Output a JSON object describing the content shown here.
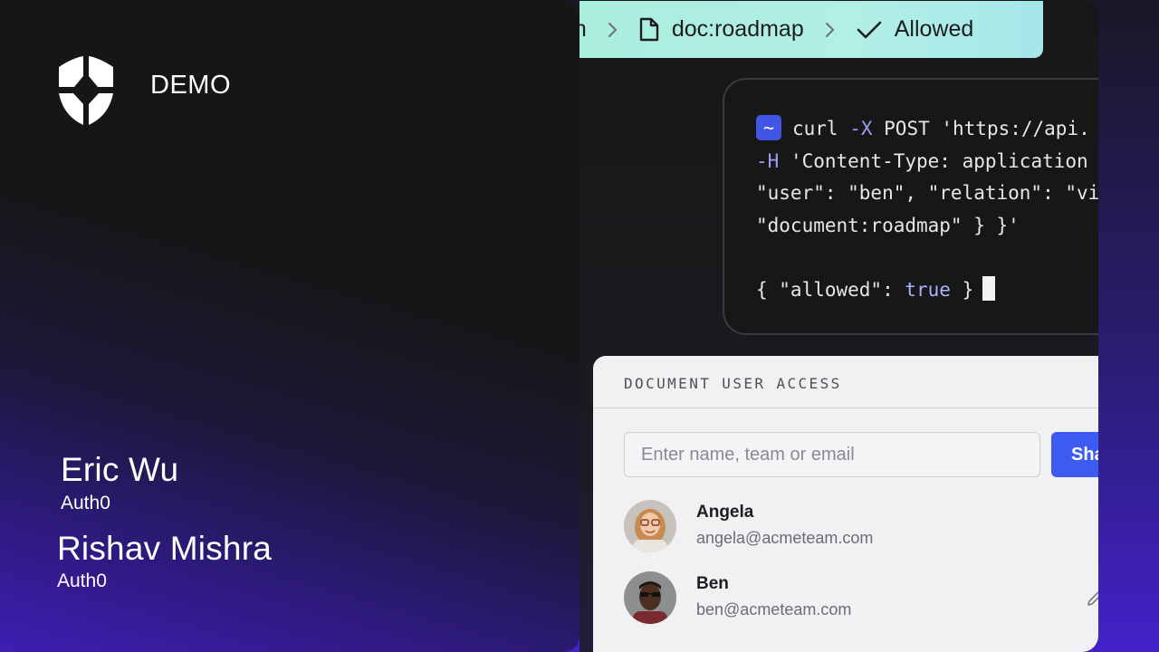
{
  "slide": {
    "brand_label": "DEMO",
    "speakers": [
      {
        "name": "Eric Wu",
        "org": "Auth0"
      },
      {
        "name": "Rishav Mishra",
        "org": "Auth0"
      }
    ]
  },
  "breadcrumb": {
    "user": "en",
    "document": "doc:roadmap",
    "result": "Allowed"
  },
  "terminal": {
    "prompt": "~",
    "line1_cmd": "curl ",
    "line1_flag": "-X",
    "line1_rest": " POST 'https://api.",
    "line2_flag": "-H",
    "line2_rest": " 'Content-Type: application",
    "line3": "\"user\": \"ben\", \"relation\": \"vi",
    "line4": "\"document:roadmap\" } }'",
    "response_prefix": "{ \"allowed\": ",
    "response_value": "true",
    "response_suffix": " }"
  },
  "access_card": {
    "title": "DOCUMENT USER ACCESS",
    "search_placeholder": "Enter name, team or email",
    "share_label": "Share",
    "users": [
      {
        "name": "Angela",
        "email": "angela@acmeteam.com",
        "avatar": "avatar-woman-glasses"
      },
      {
        "name": "Ben",
        "email": "ben@acmeteam.com",
        "avatar": "avatar-man-sunglasses"
      }
    ]
  },
  "colors": {
    "accent_blue": "#3d5af1",
    "breadcrumb_mint": "#a9eedd",
    "background_purple": "#3c1fb2"
  },
  "icons": [
    "auth0-shield-icon",
    "chevron-right-icon",
    "document-icon",
    "check-icon",
    "pencil-icon"
  ]
}
